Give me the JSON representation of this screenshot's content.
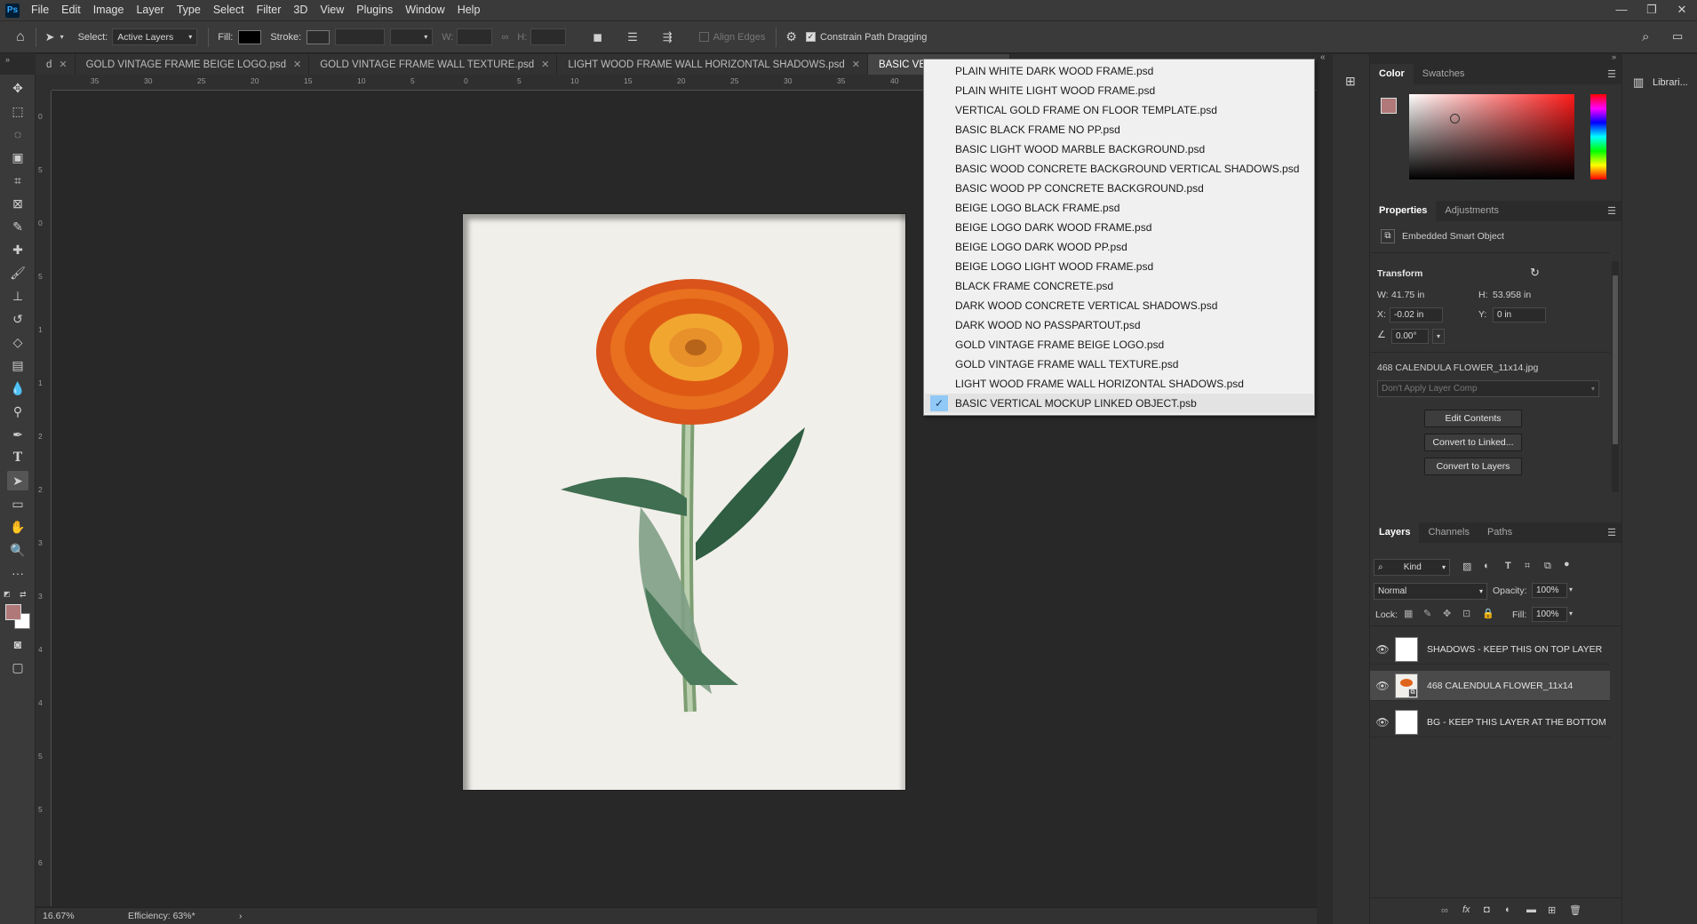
{
  "menubar": {
    "logo": "Ps",
    "items": [
      "File",
      "Edit",
      "Image",
      "Layer",
      "Type",
      "Select",
      "Filter",
      "3D",
      "View",
      "Plugins",
      "Window",
      "Help"
    ],
    "window_controls": [
      "—",
      "❐",
      "✕"
    ]
  },
  "options": {
    "select_label": "Select:",
    "select_value": "Active Layers",
    "fill_label": "Fill:",
    "stroke_label": "Stroke:",
    "w_label": "W:",
    "h_label": "H:",
    "align_edges": "Align Edges",
    "constrain": "Constrain Path Dragging"
  },
  "tabs": [
    {
      "label": "d",
      "active": false
    },
    {
      "label": "GOLD VINTAGE FRAME BEIGE LOGO.psd",
      "active": false
    },
    {
      "label": "GOLD VINTAGE FRAME WALL TEXTURE.psd",
      "active": false
    },
    {
      "label": "LIGHT WOOD FRAME WALL HORIZONTAL SHADOWS.psd",
      "active": false
    },
    {
      "label": "BASIC VERTICAL MOCK",
      "active": true
    }
  ],
  "ruler": {
    "h_ticks": [
      "35",
      "30",
      "25",
      "20",
      "15",
      "10",
      "5",
      "0",
      "5",
      "10",
      "15",
      "20",
      "25",
      "30",
      "35",
      "40"
    ],
    "v_ticks": [
      "0",
      "5",
      "0",
      "5",
      "1",
      "1",
      "2",
      "2",
      "3",
      "3",
      "4",
      "4",
      "5",
      "5",
      "6"
    ]
  },
  "document_menu": {
    "items": [
      {
        "label": "PLAIN WHITE DARK WOOD FRAME.psd",
        "checked": false
      },
      {
        "label": "PLAIN WHITE LIGHT WOOD FRAME.psd",
        "checked": false
      },
      {
        "label": "VERTICAL GOLD FRAME ON FLOOR TEMPLATE.psd",
        "checked": false
      },
      {
        "label": "BASIC BLACK FRAME NO PP.psd",
        "checked": false
      },
      {
        "label": "BASIC LIGHT WOOD MARBLE BACKGROUND.psd",
        "checked": false
      },
      {
        "label": "BASIC WOOD CONCRETE BACKGROUND VERTICAL SHADOWS.psd",
        "checked": false
      },
      {
        "label": "BASIC WOOD PP CONCRETE BACKGROUND.psd",
        "checked": false
      },
      {
        "label": "BEIGE LOGO BLACK FRAME.psd",
        "checked": false
      },
      {
        "label": "BEIGE LOGO DARK WOOD FRAME.psd",
        "checked": false
      },
      {
        "label": "BEIGE LOGO DARK WOOD PP.psd",
        "checked": false
      },
      {
        "label": "BEIGE LOGO LIGHT WOOD FRAME.psd",
        "checked": false
      },
      {
        "label": "BLACK FRAME CONCRETE.psd",
        "checked": false
      },
      {
        "label": "DARK WOOD CONCRETE VERTICAL SHADOWS.psd",
        "checked": false
      },
      {
        "label": "DARK WOOD NO PASSPARTOUT.psd",
        "checked": false
      },
      {
        "label": "GOLD VINTAGE FRAME BEIGE LOGO.psd",
        "checked": false
      },
      {
        "label": "GOLD VINTAGE FRAME WALL TEXTURE.psd",
        "checked": false
      },
      {
        "label": "LIGHT WOOD FRAME WALL HORIZONTAL SHADOWS.psd",
        "checked": false
      },
      {
        "label": "BASIC VERTICAL MOCKUP LINKED OBJECT.psb",
        "checked": true
      }
    ]
  },
  "status": {
    "zoom": "16.67%",
    "efficiency": "Efficiency: 63%*",
    "arrow": "›"
  },
  "color_panel": {
    "tabs": [
      "Color",
      "Swatches"
    ],
    "foreground": "#b07878",
    "hue_color": "#ff1a1a"
  },
  "properties": {
    "tabs": [
      "Properties",
      "Adjustments"
    ],
    "type_label": "Embedded Smart Object",
    "transform_label": "Transform",
    "w_label": "W:",
    "w_value": "41.75 in",
    "h_label": "H:",
    "h_value": "53.958 in",
    "x_label": "X:",
    "x_value": "-0.02 in",
    "y_label": "Y:",
    "y_value": "0 in",
    "angle_value": "0.00°",
    "filename": "468 CALENDULA FLOWER_11x14.jpg",
    "layer_comp": "Don't Apply Layer Comp",
    "buttons": [
      "Edit Contents",
      "Convert to Linked...",
      "Convert to Layers"
    ]
  },
  "layers_panel": {
    "tabs": [
      "Layers",
      "Channels",
      "Paths"
    ],
    "filter_kind": "Kind",
    "blend_mode": "Normal",
    "opacity_label": "Opacity:",
    "opacity_value": "100%",
    "lock_label": "Lock:",
    "fill_label": "Fill:",
    "fill_value": "100%",
    "layers": [
      {
        "name": "SHADOWS - KEEP THIS ON TOP LAYER",
        "selected": false
      },
      {
        "name": "468 CALENDULA FLOWER_11x14",
        "selected": true
      },
      {
        "name": "BG - KEEP THIS LAYER AT THE BOTTOM",
        "selected": false
      }
    ]
  },
  "libraries": {
    "label": "Librari..."
  }
}
